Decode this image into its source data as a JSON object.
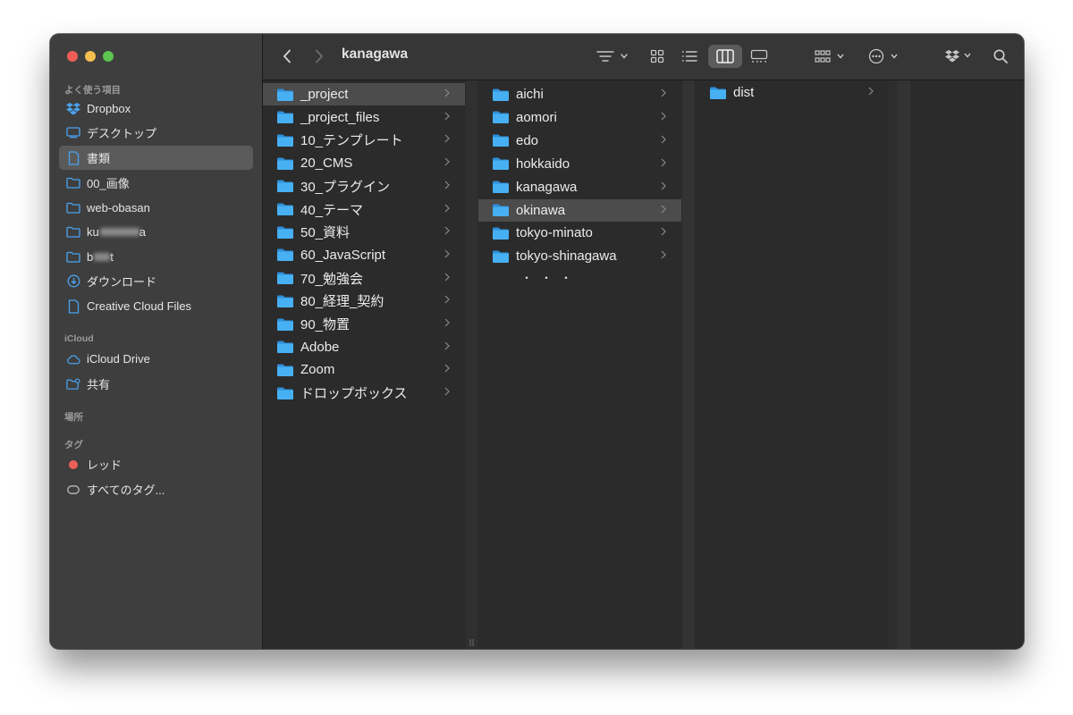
{
  "window": {
    "title": "kanagawa"
  },
  "sidebar": {
    "favorites_title": "よく使う項目",
    "favorites": [
      {
        "label": "Dropbox",
        "icon": "dropbox-icon"
      },
      {
        "label": "デスクトップ",
        "icon": "desktop-icon"
      },
      {
        "label": "書類",
        "icon": "document-icon"
      },
      {
        "label": "00_画像",
        "icon": "folder-icon"
      },
      {
        "label": "web-obasan",
        "icon": "folder-icon"
      },
      {
        "label": "ku",
        "icon": "folder-icon"
      },
      {
        "label": "b",
        "icon": "folder-icon"
      },
      {
        "label": "ダウンロード",
        "icon": "download-icon"
      },
      {
        "label": "Creative Cloud Files",
        "icon": "document-icon"
      }
    ],
    "icloud_title": "iCloud",
    "icloud": [
      {
        "label": "iCloud Drive",
        "icon": "cloud-icon"
      },
      {
        "label": "共有",
        "icon": "shared-folder-icon"
      }
    ],
    "locations_title": "場所",
    "tags_title": "タグ",
    "tags": [
      {
        "label": "レッド",
        "color": "#ec5f59"
      },
      {
        "label": "すべてのタグ...",
        "color": ""
      }
    ]
  },
  "columns": {
    "col1": [
      "_project",
      "_project_files",
      "10_テンプレート",
      "20_CMS",
      "30_プラグイン",
      "40_テーマ",
      "50_資料",
      "60_JavaScript",
      "70_勉強会",
      "80_経理_契約",
      "90_物置",
      "Adobe",
      "Zoom",
      "ドロップボックス"
    ],
    "col2": [
      "aichi",
      "aomori",
      "edo",
      "hokkaido",
      "kanagawa",
      "okinawa",
      "tokyo-minato",
      "tokyo-shinagawa"
    ],
    "col2_more": "・・・",
    "col3": [
      "dist"
    ]
  },
  "colors": {
    "folder": "#3aa0e6",
    "accent": "#3a86f0",
    "sidebar": "#3e3e3e",
    "content": "#2b2b2b"
  }
}
